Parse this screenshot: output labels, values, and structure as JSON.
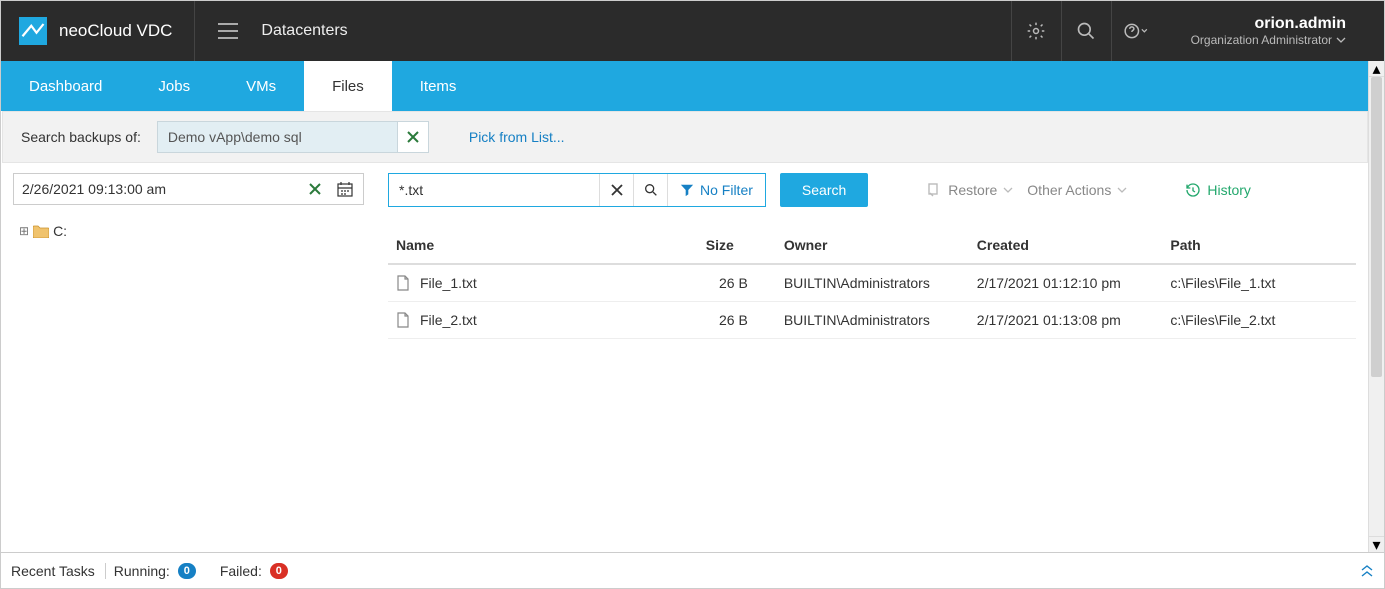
{
  "brand": {
    "name": "neoCloud VDC"
  },
  "topnav": {
    "datacenters": "Datacenters"
  },
  "user": {
    "name": "orion.admin",
    "role": "Organization Administrator"
  },
  "tabs": {
    "dashboard": "Dashboard",
    "jobs": "Jobs",
    "vms": "VMs",
    "files": "Files",
    "items": "Items",
    "active": "files"
  },
  "searchbar": {
    "label": "Search backups of:",
    "source": "Demo vApp\\demo sql",
    "pick": "Pick from List..."
  },
  "restore_point": {
    "value": "2/26/2021 09:13:00 am"
  },
  "tree": {
    "root": "C:"
  },
  "file_search": {
    "query": "*.txt",
    "filter_label": "No Filter"
  },
  "actions": {
    "search": "Search",
    "restore": "Restore",
    "other": "Other Actions",
    "history": "History"
  },
  "columns": {
    "name": "Name",
    "size": "Size",
    "owner": "Owner",
    "created": "Created",
    "path": "Path"
  },
  "rows": [
    {
      "name": "File_1.txt",
      "size": "26 B",
      "owner": "BUILTIN\\Administrators",
      "created": "2/17/2021 01:12:10 pm",
      "path": "c:\\Files\\File_1.txt"
    },
    {
      "name": "File_2.txt",
      "size": "26 B",
      "owner": "BUILTIN\\Administrators",
      "created": "2/17/2021 01:13:08 pm",
      "path": "c:\\Files\\File_2.txt"
    }
  ],
  "bottom": {
    "recent": "Recent Tasks",
    "running": "Running:",
    "running_count": "0",
    "failed": "Failed:",
    "failed_count": "0"
  }
}
